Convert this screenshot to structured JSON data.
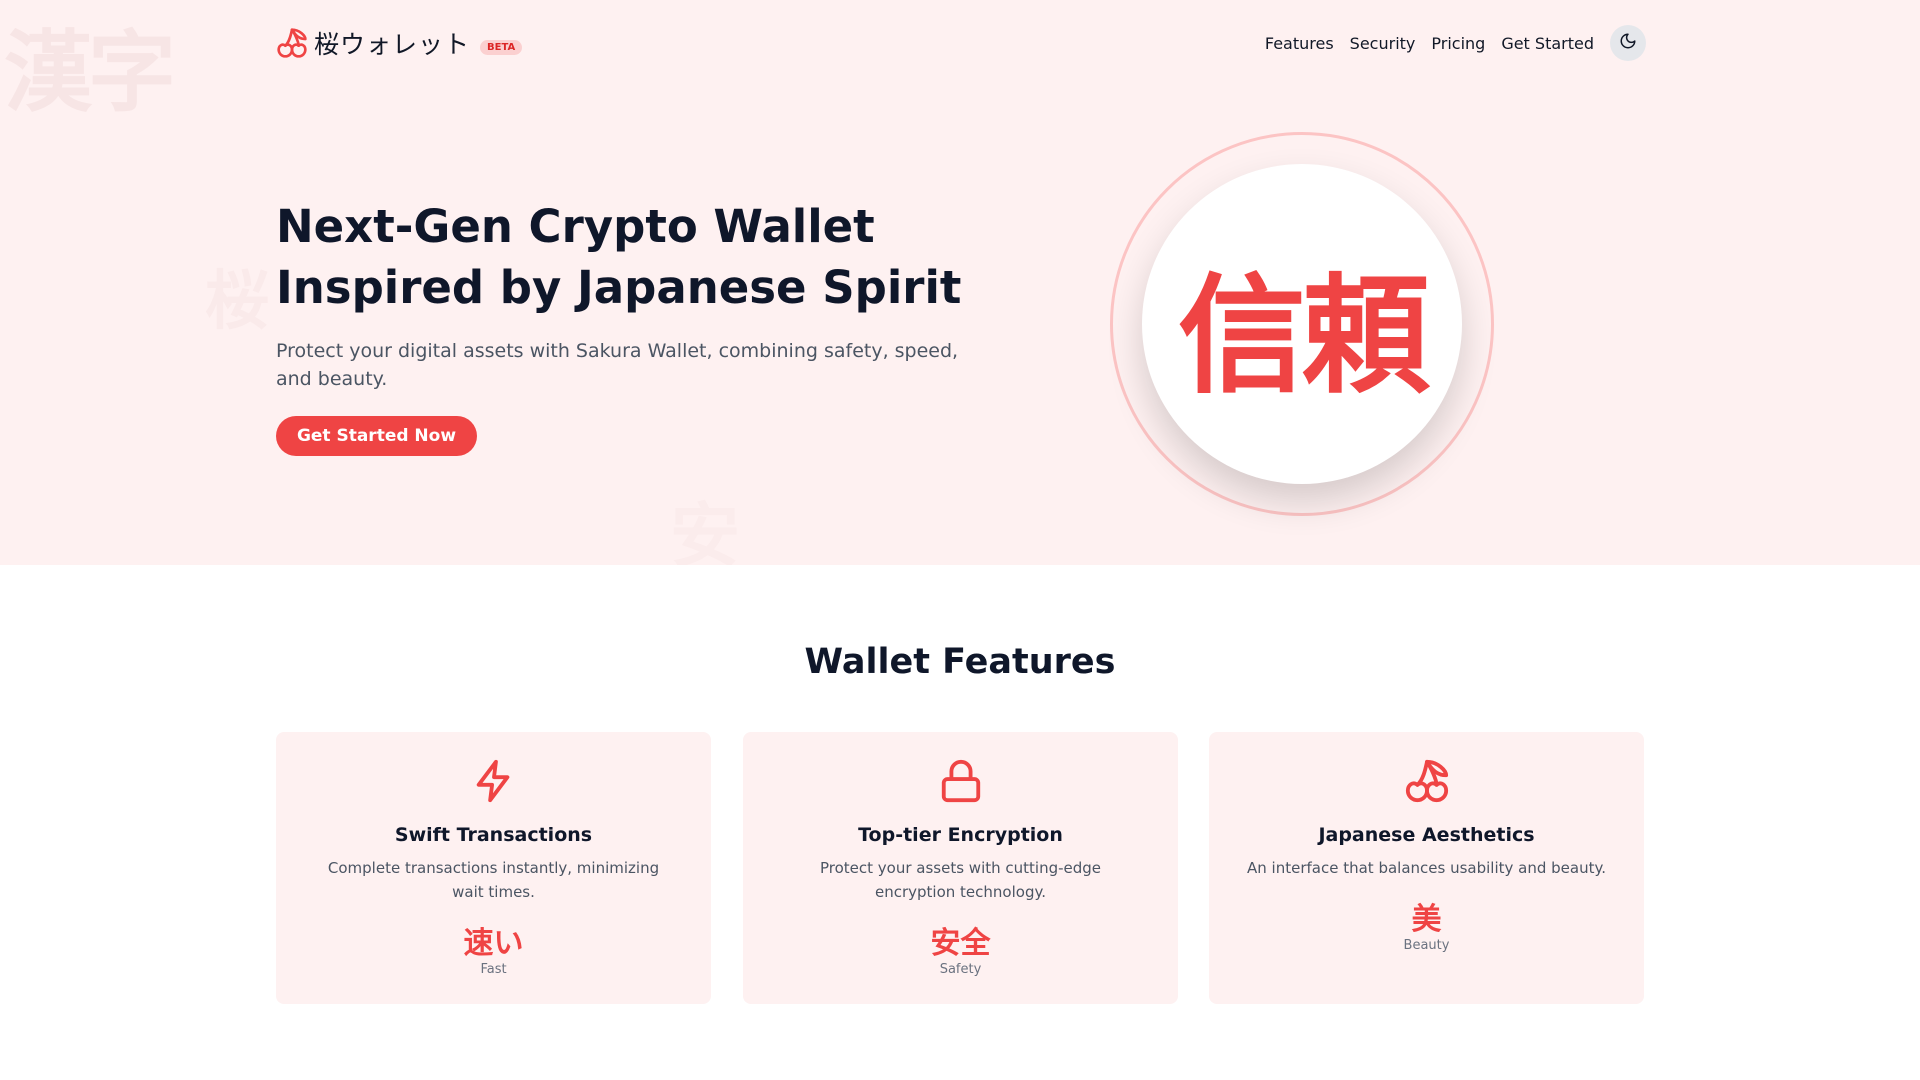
{
  "brand": {
    "name": "桜ウォレット",
    "badge": "BETA",
    "logo_icon": "cherry-icon"
  },
  "nav": {
    "links": [
      "Features",
      "Security",
      "Pricing",
      "Get Started"
    ],
    "theme_toggle_icon": "moon-icon"
  },
  "hero": {
    "title_line1": "Next-Gen Crypto Wallet",
    "title_line2": "Inspired by Japanese Spirit",
    "subtitle": "Protect your digital assets with Sakura Wallet, combining safety, speed, and beauty.",
    "cta": "Get Started Now",
    "circle_kanji": "信頼",
    "watermarks": [
      "漢字",
      "桜",
      "安"
    ]
  },
  "features": {
    "title": "Wallet Features",
    "cards": [
      {
        "icon": "lightning-bolt-icon",
        "title": "Swift Transactions",
        "description": "Complete transactions instantly, minimizing wait times.",
        "kanji": "速い",
        "kanji_label": "Fast"
      },
      {
        "icon": "lock-icon",
        "title": "Top-tier Encryption",
        "description": "Protect your assets with cutting-edge encryption technology.",
        "kanji": "安全",
        "kanji_label": "Safety"
      },
      {
        "icon": "cherry-icon",
        "title": "Japanese Aesthetics",
        "description": "An interface that balances usability and beauty.",
        "kanji": "美",
        "kanji_label": "Beauty"
      }
    ]
  },
  "colors": {
    "accent": "#ef4444",
    "hero_bg": "#fef1f1",
    "card_bg": "#fef1f1",
    "text_dark": "#0f172a",
    "text_muted": "#4b5563"
  }
}
